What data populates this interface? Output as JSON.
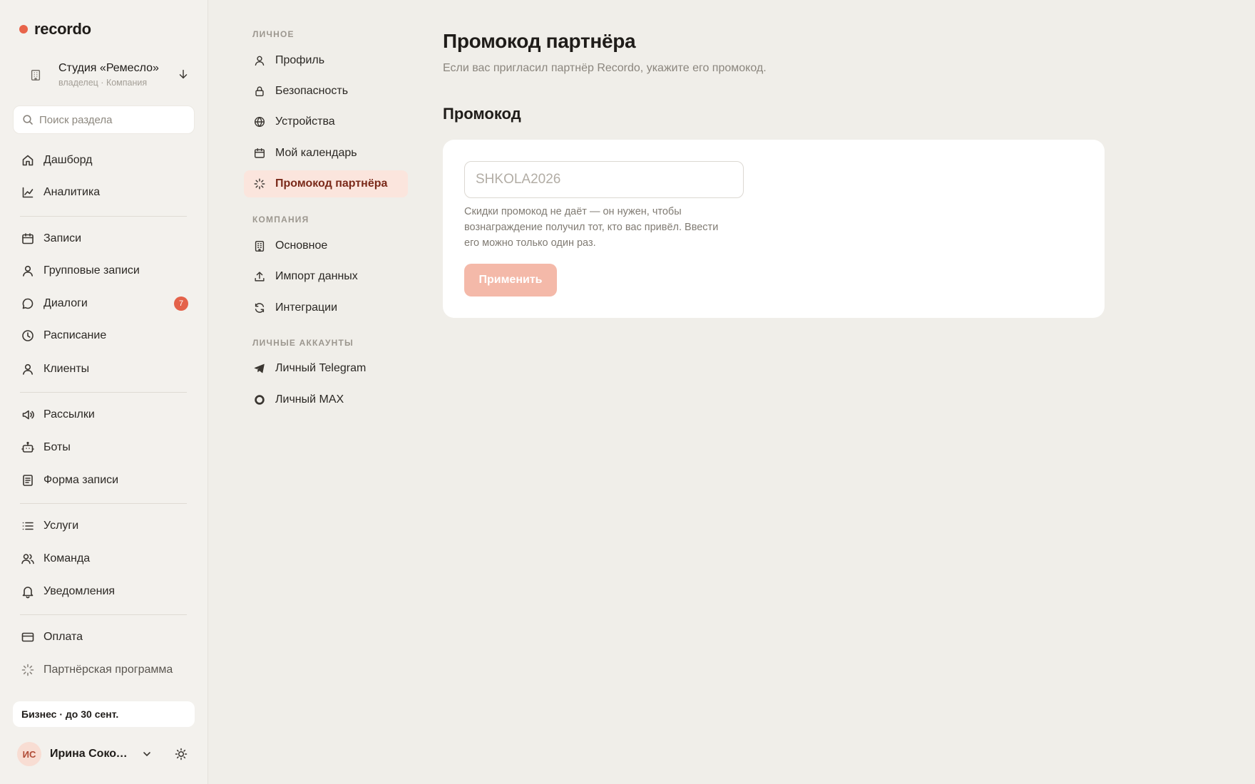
{
  "app": {
    "logo_text": "recordo",
    "accent_color": "#e8644a"
  },
  "org": {
    "name": "Студия «Ремесло»",
    "role": "владелец · Компания"
  },
  "search": {
    "placeholder": "Поиск раздела"
  },
  "sidebar": {
    "items": [
      {
        "label": "Дашборд",
        "icon": "home-icon"
      },
      {
        "label": "Аналитика",
        "icon": "chart-icon"
      },
      {
        "label": "Записи",
        "icon": "calendar-icon"
      },
      {
        "label": "Групповые записи",
        "icon": "user-icon"
      },
      {
        "label": "Диалоги",
        "icon": "chat-icon",
        "badge": "7"
      },
      {
        "label": "Расписание",
        "icon": "clock-icon"
      },
      {
        "label": "Клиенты",
        "icon": "user-icon"
      },
      {
        "label": "Рассылки",
        "icon": "megaphone-icon"
      },
      {
        "label": "Боты",
        "icon": "bot-icon"
      },
      {
        "label": "Форма записи",
        "icon": "form-icon"
      },
      {
        "label": "Услуги",
        "icon": "list-icon"
      },
      {
        "label": "Команда",
        "icon": "team-icon"
      },
      {
        "label": "Уведомления",
        "icon": "bell-icon"
      },
      {
        "label": "Оплата",
        "icon": "card-icon"
      },
      {
        "label": "Партнёрская программа",
        "icon": "sparkle-icon"
      }
    ]
  },
  "plan": {
    "label": "Бизнес · до 30 сент."
  },
  "user": {
    "initials": "ИС",
    "name": "Ирина Соколова"
  },
  "settings_nav": {
    "personal_header": "ЛИЧНОЕ",
    "personal": [
      {
        "label": "Профиль",
        "icon": "user-icon"
      },
      {
        "label": "Безопасность",
        "icon": "lock-icon"
      },
      {
        "label": "Устройства",
        "icon": "globe-icon"
      },
      {
        "label": "Мой календарь",
        "icon": "calendar-icon"
      },
      {
        "label": "Промокод партнёра",
        "icon": "sparkle-icon",
        "active": true
      }
    ],
    "company_header": "КОМПАНИЯ",
    "company": [
      {
        "label": "Основное",
        "icon": "building-icon"
      },
      {
        "label": "Импорт данных",
        "icon": "upload-icon"
      },
      {
        "label": "Интеграции",
        "icon": "refresh-icon"
      }
    ],
    "accounts_header": "ЛИЧНЫЕ АККАУНТЫ",
    "accounts": [
      {
        "label": "Личный Telegram",
        "icon": "telegram-icon"
      },
      {
        "label": "Личный MAX",
        "icon": "max-icon"
      }
    ]
  },
  "main": {
    "title": "Промокод партнёра",
    "subtitle": "Если вас пригласил партнёр Recordo, укажите его промокод.",
    "section_title": "Промокод",
    "promo_placeholder": "SHKOLA2026",
    "promo_value": "",
    "hint": "Скидки промокод не даёт — он нужен, чтобы вознаграждение получил тот, кто вас привёл. Ввести его можно только один раз.",
    "apply_label": "Применить"
  }
}
